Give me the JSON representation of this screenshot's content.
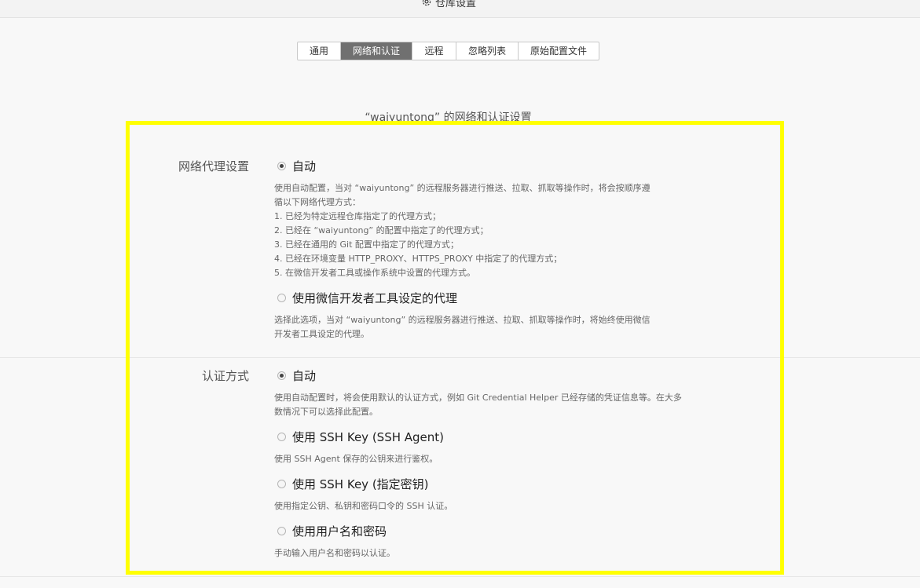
{
  "window": {
    "title": "仓库设置"
  },
  "tabs": [
    {
      "label": "通用",
      "active": false
    },
    {
      "label": "网络和认证",
      "active": true
    },
    {
      "label": "远程",
      "active": false
    },
    {
      "label": "忽略列表",
      "active": false
    },
    {
      "label": "原始配置文件",
      "active": false
    }
  ],
  "page": {
    "title": "“waiyuntong” 的网络和认证设置"
  },
  "proxy": {
    "label": "网络代理设置",
    "options": [
      {
        "label": "自动",
        "checked": true,
        "desc": [
          "使用自动配置，当对 “waiyuntong” 的远程服务器进行推送、拉取、抓取等操作时，将会按顺序遵",
          "循以下网络代理方式：",
          "1. 已经为特定远程仓库指定了的代理方式；",
          "2. 已经在 “waiyuntong” 的配置中指定了的代理方式；",
          "3. 已经在通用的 Git 配置中指定了的代理方式；",
          "4. 已经在环境变量 HTTP_PROXY、HTTPS_PROXY 中指定了的代理方式；",
          "5. 在微信开发者工具或操作系统中设置的代理方式。"
        ]
      },
      {
        "label": "使用微信开发者工具设定的代理",
        "checked": false,
        "desc": [
          "选择此选项，当对 “waiyuntong” 的远程服务器进行推送、拉取、抓取等操作时，将始终使用微信",
          "开发者工具设定的代理。"
        ]
      }
    ]
  },
  "auth": {
    "label": "认证方式",
    "options": [
      {
        "label": "自动",
        "checked": true,
        "desc": [
          "使用自动配置时，将会使用默认的认证方式，例如 Git Credential Helper 已经存储的凭证信息等。在大多",
          "数情况下可以选择此配置。"
        ]
      },
      {
        "label": "使用 SSH Key (SSH Agent)",
        "checked": false,
        "desc": [
          "使用 SSH Agent 保存的公钥来进行鉴权。"
        ]
      },
      {
        "label": "使用 SSH Key (指定密钥)",
        "checked": false,
        "desc": [
          "使用指定公钥、私钥和密码口令的 SSH 认证。"
        ]
      },
      {
        "label": "使用用户名和密码",
        "checked": false,
        "desc": [
          "手动输入用户名和密码以认证。"
        ]
      }
    ]
  },
  "colors": {
    "highlight": "#ffff00",
    "active_tab": "#707070"
  }
}
